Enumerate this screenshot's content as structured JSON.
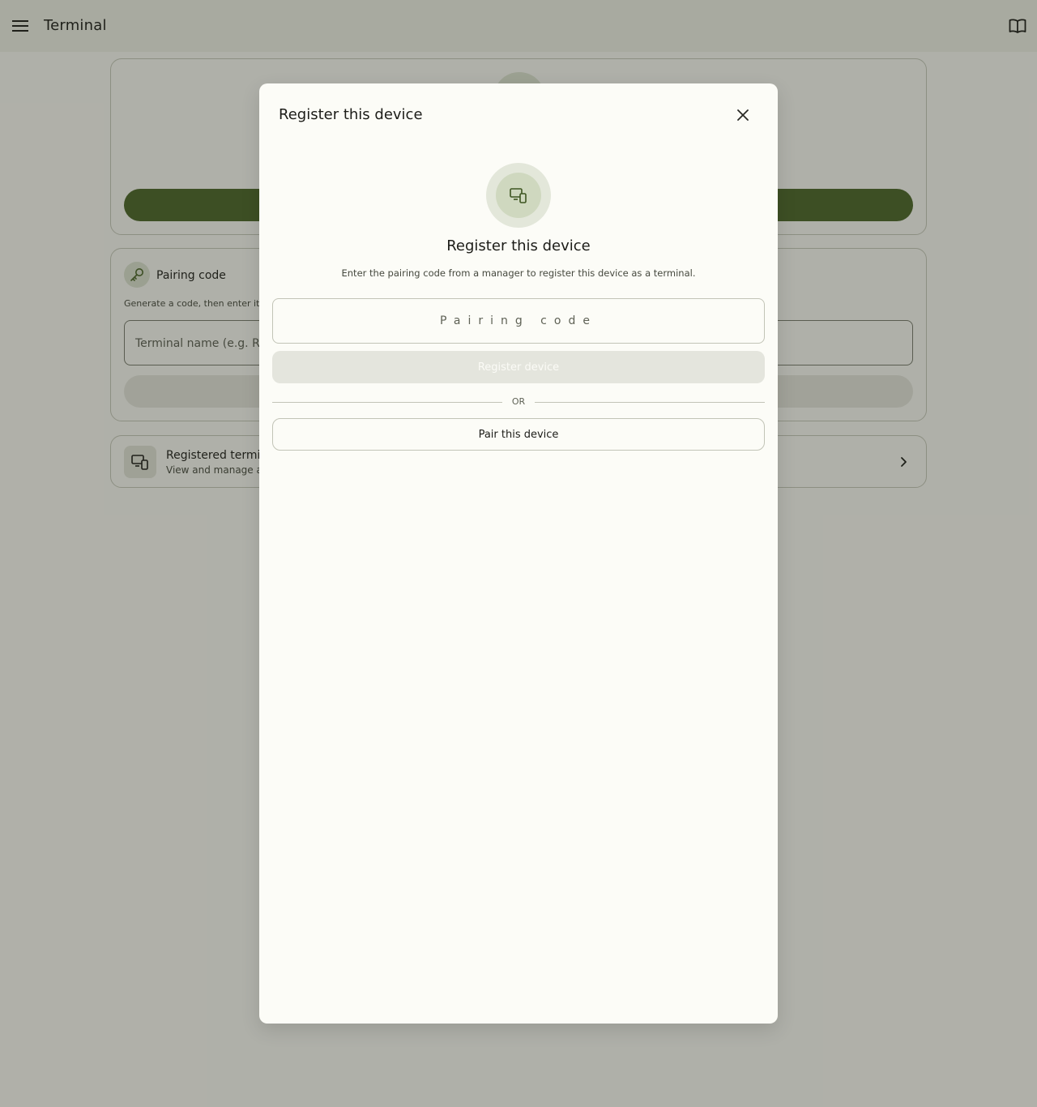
{
  "appbar": {
    "title": "Terminal",
    "menu_icon": "menu-icon",
    "docs_icon": "book-icon"
  },
  "background": {
    "pairing_card": {
      "icon": "key-icon",
      "title": "Pairing code",
      "description": "Generate a code, then enter it o",
      "input_placeholder": "Terminal name (e.g. Regi"
    },
    "terminals_card": {
      "icon": "devices-icon",
      "title": "Registered termin",
      "subtitle": "View and manage all",
      "chevron_icon": "chevron-right-icon"
    }
  },
  "dialog": {
    "title": "Register this device",
    "close_icon": "close-icon",
    "hero_icon": "devices-icon",
    "heading": "Register this device",
    "description": "Enter the pairing code from a manager to register this device as a terminal.",
    "code_input": {
      "placeholder": "Pairing code",
      "value": ""
    },
    "register_button": "Register device",
    "divider_text": "OR",
    "pair_button": "Pair this device"
  },
  "colors": {
    "primary": "#4a6428",
    "surface": "#fcfcf7",
    "appbar": "#f1f3ea",
    "outline": "#c2c4b7"
  }
}
